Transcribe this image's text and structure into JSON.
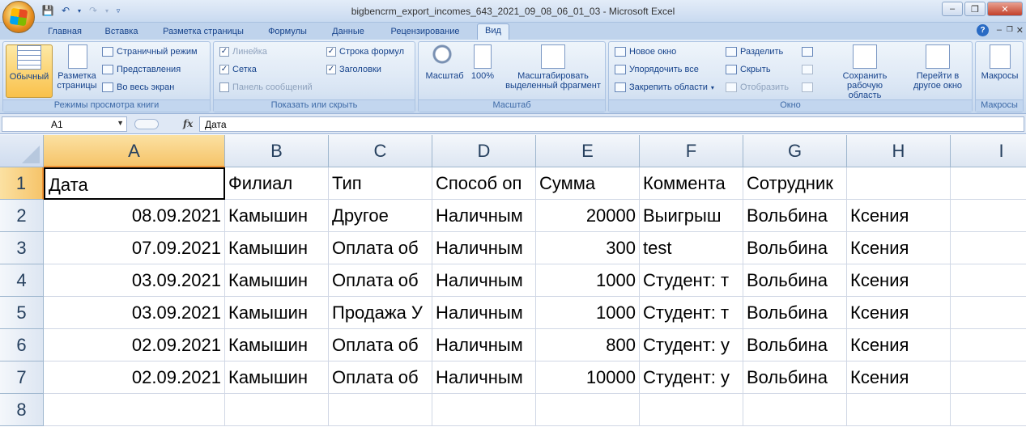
{
  "window": {
    "title": "bigbencrm_export_incomes_643_2021_09_08_06_01_03 - Microsoft Excel"
  },
  "tabs": [
    "Главная",
    "Вставка",
    "Разметка страницы",
    "Формулы",
    "Данные",
    "Рецензирование",
    "Вид"
  ],
  "active_tab": "Вид",
  "ribbon": {
    "views": {
      "normal": "Обычный",
      "page_layout": "Разметка страницы",
      "page_break": "Страничный режим",
      "custom_views": "Представления",
      "full_screen": "Во весь экран",
      "caption": "Режимы просмотра книги"
    },
    "show_hide": {
      "ruler": "Линейка",
      "gridlines": "Сетка",
      "message_bar": "Панель сообщений",
      "formula_bar": "Строка формул",
      "headings": "Заголовки",
      "caption": "Показать или скрыть",
      "ruler_checked": true,
      "gridlines_checked": true,
      "message_bar_checked": false,
      "formula_bar_checked": true,
      "headings_checked": true
    },
    "zoom": {
      "zoom": "Масштаб",
      "hundred": "100%",
      "zoom_selection": "Масштабировать выделенный фрагмент",
      "caption": "Масштаб"
    },
    "window": {
      "new_window": "Новое окно",
      "arrange_all": "Упорядочить все",
      "freeze_panes": "Закрепить области",
      "split": "Разделить",
      "hide": "Скрыть",
      "unhide": "Отобразить",
      "save_workspace": "Сохранить рабочую область",
      "switch_windows": "Перейти в другое окно",
      "caption": "Окно"
    },
    "macros": {
      "macros": "Макросы",
      "caption": "Макросы"
    }
  },
  "formula_bar": {
    "name_box": "A1",
    "fx": "fx",
    "content": "Дата"
  },
  "columns": [
    "A",
    "B",
    "C",
    "D",
    "E",
    "F",
    "G",
    "H",
    "I"
  ],
  "rows": [
    "1",
    "2",
    "3",
    "4",
    "5",
    "6",
    "7",
    "8"
  ],
  "cells": [
    [
      "Дата",
      "Филиал",
      "Тип",
      "Способ оп",
      "Сумма",
      "Коммента",
      "Сотрудник",
      ""
    ],
    [
      "08.09.2021",
      "Камышин",
      "Другое",
      "Наличным",
      "20000",
      "Выигрыш",
      "Вольбина",
      "Ксения"
    ],
    [
      "07.09.2021",
      "Камышин",
      "Оплата об",
      "Наличным",
      "300",
      "test",
      "Вольбина",
      "Ксения"
    ],
    [
      "03.09.2021",
      "Камышин",
      "Оплата об",
      "Наличным",
      "1000",
      "Студент: т",
      "Вольбина",
      "Ксения"
    ],
    [
      "03.09.2021",
      "Камышин",
      "Продажа У",
      "Наличным",
      "1000",
      "Студент: т",
      "Вольбина",
      "Ксения"
    ],
    [
      "02.09.2021",
      "Камышин",
      "Оплата об",
      "Наличным",
      "800",
      "Студент: у",
      "Вольбина",
      "Ксения"
    ],
    [
      "02.09.2021",
      "Камышин",
      "Оплата об",
      "Наличным",
      "10000",
      "Студент: у",
      "Вольбина",
      "Ксения"
    ]
  ]
}
